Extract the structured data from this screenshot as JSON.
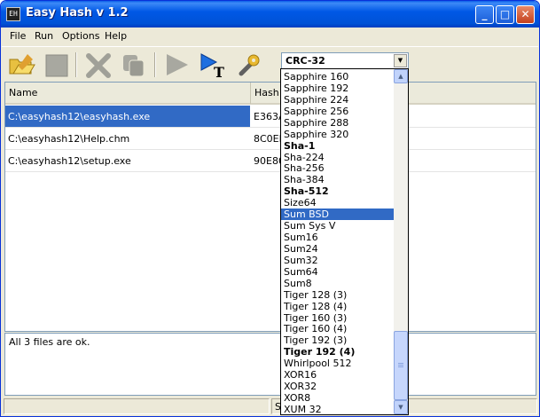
{
  "window": {
    "title": "Easy Hash v 1.2",
    "icon_text": "EH"
  },
  "menu": [
    "File",
    "Run",
    "Options",
    "Help"
  ],
  "toolbar": {
    "algorithm_selected": "CRC-32",
    "icons": [
      "open-folder-icon",
      "stop-icon",
      "delete-icon",
      "copy-icon",
      "run-icon",
      "text-hash-icon",
      "settings-wrench-icon"
    ]
  },
  "list": {
    "columns": [
      "Name",
      "Hash"
    ],
    "rows": [
      {
        "name": "C:\\easyhash12\\easyhash.exe",
        "hash": "E363A0"
      },
      {
        "name": "C:\\easyhash12\\Help.chm",
        "hash": "8C0EE"
      },
      {
        "name": "C:\\easyhash12\\setup.exe",
        "hash": "90E800"
      }
    ],
    "selected_row": 0
  },
  "status_message": "All 3 files are ok.",
  "statusbar": {
    "panel_text": "Se"
  },
  "dropdown": {
    "highlighted": "Sum BSD",
    "items": [
      {
        "label": "Sapphire 160",
        "bold": false
      },
      {
        "label": "Sapphire 192",
        "bold": false
      },
      {
        "label": "Sapphire 224",
        "bold": false
      },
      {
        "label": "Sapphire 256",
        "bold": false
      },
      {
        "label": "Sapphire 288",
        "bold": false
      },
      {
        "label": "Sapphire 320",
        "bold": false
      },
      {
        "label": "Sha-1",
        "bold": true
      },
      {
        "label": "Sha-224",
        "bold": false
      },
      {
        "label": "Sha-256",
        "bold": false
      },
      {
        "label": "Sha-384",
        "bold": false
      },
      {
        "label": "Sha-512",
        "bold": true
      },
      {
        "label": "Size64",
        "bold": false
      },
      {
        "label": "Sum BSD",
        "bold": false
      },
      {
        "label": "Sum Sys V",
        "bold": false
      },
      {
        "label": "Sum16",
        "bold": false
      },
      {
        "label": "Sum24",
        "bold": false
      },
      {
        "label": "Sum32",
        "bold": false
      },
      {
        "label": "Sum64",
        "bold": false
      },
      {
        "label": "Sum8",
        "bold": false
      },
      {
        "label": "Tiger 128 (3)",
        "bold": false
      },
      {
        "label": "Tiger 128 (4)",
        "bold": false
      },
      {
        "label": "Tiger 160 (3)",
        "bold": false
      },
      {
        "label": "Tiger 160 (4)",
        "bold": false
      },
      {
        "label": "Tiger 192 (3)",
        "bold": false
      },
      {
        "label": "Tiger 192 (4)",
        "bold": true
      },
      {
        "label": "Whirlpool 512",
        "bold": false
      },
      {
        "label": "XOR16",
        "bold": false
      },
      {
        "label": "XOR32",
        "bold": false
      },
      {
        "label": "XOR8",
        "bold": false
      },
      {
        "label": "XUM 32",
        "bold": false
      }
    ]
  },
  "colors": {
    "titlebar": "#0058e6",
    "selection": "#316ac5",
    "chrome": "#ece9d8"
  }
}
